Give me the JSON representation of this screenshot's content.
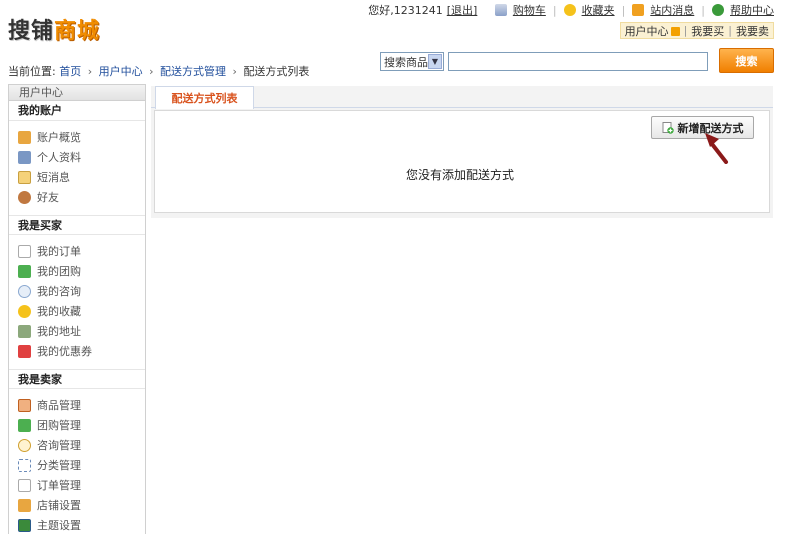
{
  "logo": {
    "part1": "搜铺",
    "part2": "商城"
  },
  "toplinks": {
    "greeting": "您好,1231241",
    "logout": "[退出]",
    "cart": "购物车",
    "favorites": "收藏夹",
    "messages": "站内消息",
    "help": "帮助中心"
  },
  "usermenu": {
    "center": "用户中心",
    "buy": "我要买",
    "sell": "我要卖"
  },
  "breadcrumb": {
    "prefix": "当前位置:",
    "items": [
      "首页",
      "用户中心",
      "配送方式管理",
      "配送方式列表"
    ],
    "sep": "›"
  },
  "search": {
    "select_value": "搜索商品",
    "button": "搜索",
    "placeholder": ""
  },
  "sidebar": {
    "header": "用户中心",
    "sections": [
      {
        "title": "我的账户",
        "items": [
          "账户概览",
          "个人资料",
          "短消息",
          "好友"
        ]
      },
      {
        "title": "我是买家",
        "items": [
          "我的订单",
          "我的团购",
          "我的咨询",
          "我的收藏",
          "我的地址",
          "我的优惠券"
        ]
      },
      {
        "title": "我是卖家",
        "items": [
          "商品管理",
          "团购管理",
          "咨询管理",
          "分类管理",
          "订单管理",
          "店铺设置",
          "主题设置"
        ]
      }
    ]
  },
  "main": {
    "tab": "配送方式列表",
    "add_button": "新增配送方式",
    "empty_message": "您没有添加配送方式"
  },
  "colors": {
    "accent": "#f08c00",
    "tab_text": "#d9531e",
    "link": "#1f4d9b",
    "arrow": "#8b1a1a"
  }
}
